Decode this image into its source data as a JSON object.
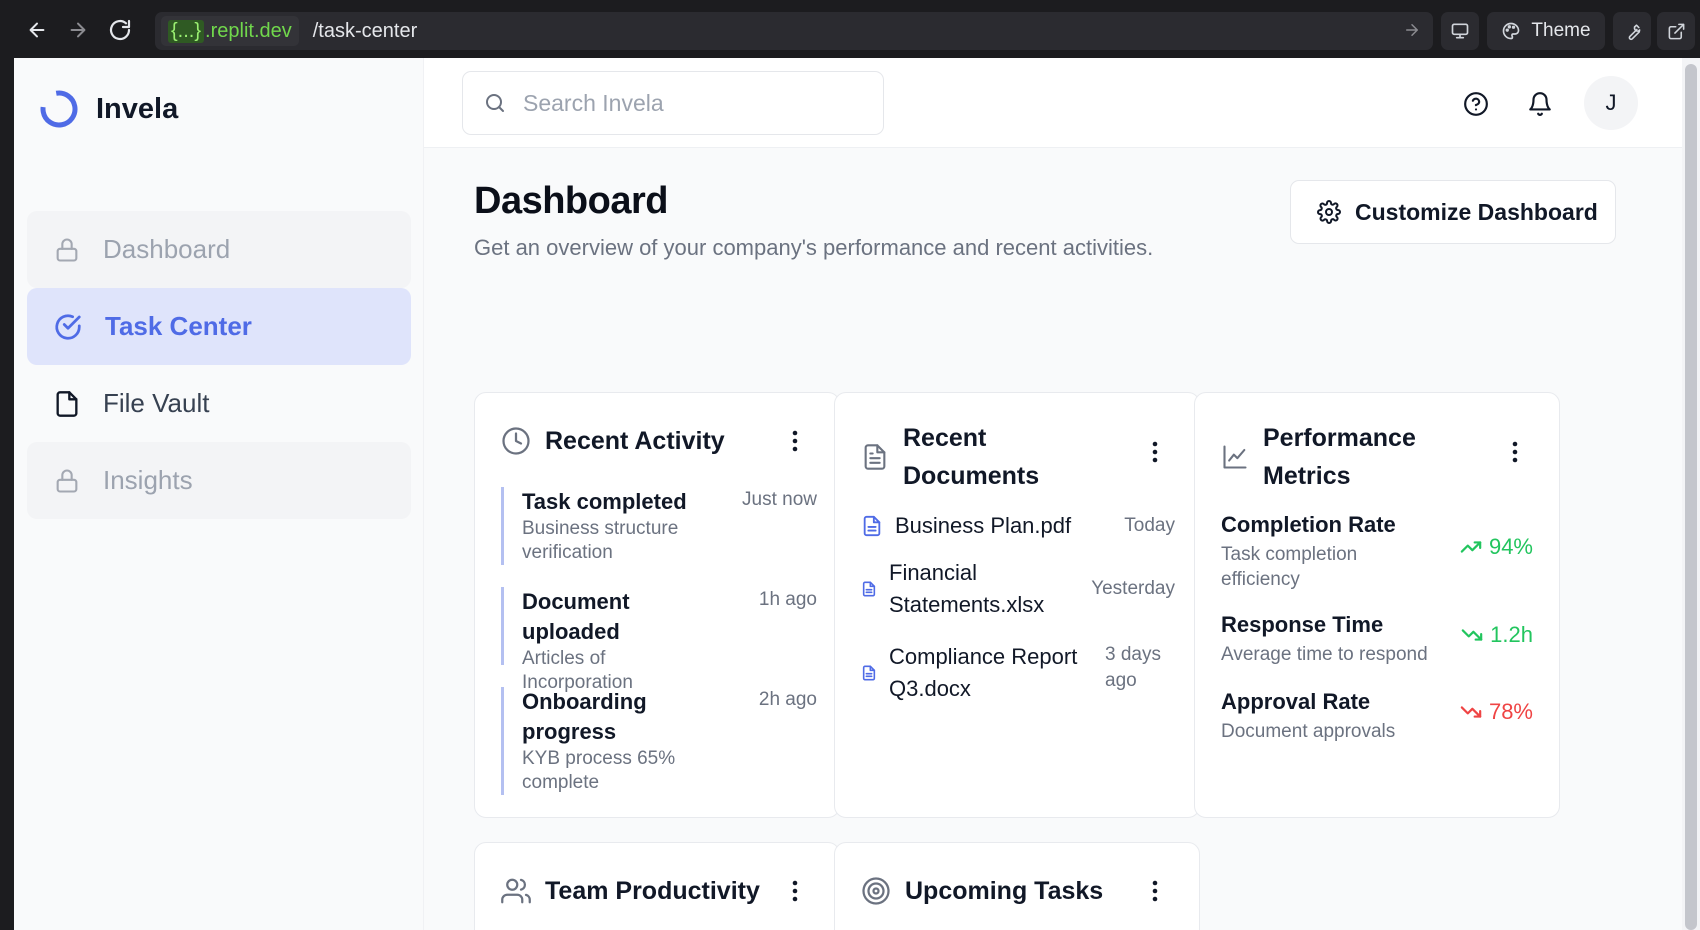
{
  "browser": {
    "url_domain_prefix": "{...}",
    "url_domain_suffix": ".replit.dev",
    "url_path": "/task-center",
    "theme_label": "Theme"
  },
  "app": {
    "name": "Invela"
  },
  "sidebar": {
    "items": [
      {
        "label": "Dashboard",
        "state": "locked"
      },
      {
        "label": "Task Center",
        "state": "active"
      },
      {
        "label": "File Vault",
        "state": "normal"
      },
      {
        "label": "Insights",
        "state": "locked"
      }
    ]
  },
  "header": {
    "search_placeholder": "Search Invela",
    "avatar_initial": "J"
  },
  "page": {
    "title": "Dashboard",
    "subtitle": "Get an overview of your company's performance and recent activities.",
    "customize_label": "Customize Dashboard"
  },
  "cards": {
    "recent_activity": {
      "title": "Recent Activity",
      "items": [
        {
          "title": "Task completed",
          "desc": "Business structure verification",
          "time": "Just now"
        },
        {
          "title": "Document uploaded",
          "desc": "Articles of Incorporation",
          "time": "1h ago"
        },
        {
          "title": "Onboarding progress",
          "desc": "KYB process 65% complete",
          "time": "2h ago"
        }
      ]
    },
    "recent_documents": {
      "title": "Recent Documents",
      "items": [
        {
          "name": "Business Plan.pdf",
          "time": "Today"
        },
        {
          "name": "Financial Statements.xlsx",
          "time": "Yesterday"
        },
        {
          "name": "Compliance Report Q3.docx",
          "time": "3 days ago"
        }
      ]
    },
    "performance_metrics": {
      "title": "Performance Metrics",
      "items": [
        {
          "label": "Completion Rate",
          "desc": "Task completion efficiency",
          "value": "94%",
          "trend": "up",
          "color": "#22c55e"
        },
        {
          "label": "Response Time",
          "desc": "Average time to respond",
          "value": "1.2h",
          "trend": "down",
          "color": "#22c55e"
        },
        {
          "label": "Approval Rate",
          "desc": "Document approvals",
          "value": "78%",
          "trend": "down",
          "color": "#ef4444"
        }
      ]
    },
    "team_productivity": {
      "title": "Team Productivity"
    },
    "upcoming_tasks": {
      "title": "Upcoming Tasks"
    }
  },
  "colors": {
    "accent": "#4f6be6",
    "active_bg": "#dfe4fb",
    "positive": "#22c55e",
    "negative": "#ef4444"
  }
}
